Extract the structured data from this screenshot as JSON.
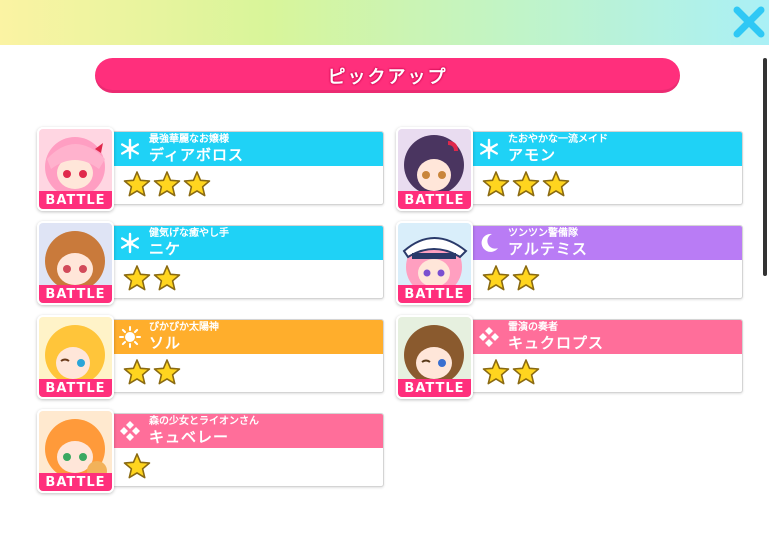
{
  "header": {
    "close_icon": "close-x-icon",
    "accent": "#2fc8f5"
  },
  "title": {
    "label": "ピックアップ",
    "color": "#ff2f7c"
  },
  "battle_label": "BATTLE",
  "cards": [
    {
      "epithet": "最強華麗なお嬢様",
      "name": "ディアボロス",
      "stars": 3,
      "attribute": "snowflake-icon",
      "color": "#1fd2f6"
    },
    {
      "epithet": "たおやかな一流メイド",
      "name": "アモン",
      "stars": 3,
      "attribute": "snowflake-icon",
      "color": "#1fd2f6"
    },
    {
      "epithet": "健気げな癒やし手",
      "name": "ニケ",
      "stars": 2,
      "attribute": "snowflake-icon",
      "color": "#1fd2f6"
    },
    {
      "epithet": "ツンツン警備隊",
      "name": "アルテミス",
      "stars": 2,
      "attribute": "moon-icon",
      "color": "#b97cf5"
    },
    {
      "epithet": "ぴかぴか太陽神",
      "name": "ソル",
      "stars": 2,
      "attribute": "sun-icon",
      "color": "#ffae2c"
    },
    {
      "epithet": "雷演の奏者",
      "name": "キュクロプス",
      "stars": 2,
      "attribute": "diamond-icon",
      "color": "#ff6e9a"
    },
    {
      "epithet": "森の少女とライオンさん",
      "name": "キュベレー",
      "stars": 1,
      "attribute": "diamond-icon",
      "color": "#ff6e9a"
    }
  ]
}
